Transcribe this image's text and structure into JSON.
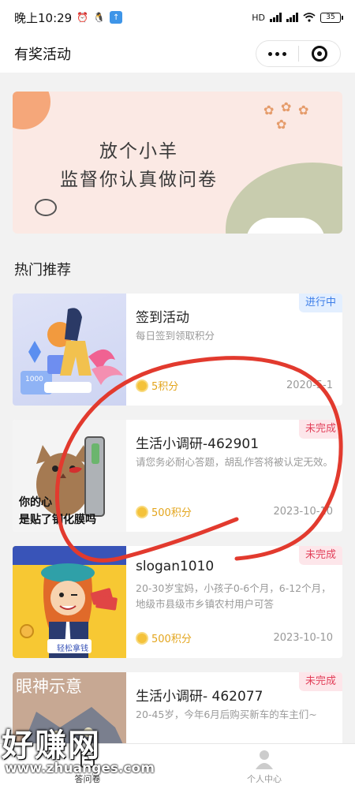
{
  "status_bar": {
    "time": "晚上10:29",
    "network": "4G",
    "hd": "HD",
    "battery": "35"
  },
  "header": {
    "title": "有奖活动",
    "more_icon": "more-dots-icon",
    "close_icon": "target-icon"
  },
  "banner": {
    "line1": "放个小羊",
    "line2": "监督你认真做问卷"
  },
  "section": {
    "title": "热门推荐"
  },
  "cards": [
    {
      "title": "签到活动",
      "desc": "每日签到领取积分",
      "points": "5积分",
      "date": "2020-5-1",
      "status": "进行中",
      "status_color": "#3d7ee8",
      "thumb_text": "1000"
    },
    {
      "title": "生活小调研-462901",
      "desc": "请您务必耐心答题，胡乱作答将被认定无效。",
      "points": "500积分",
      "date": "2023-10-10",
      "status": "未完成",
      "status_color": "#e2405a",
      "thumb_text_1": "你的心",
      "thumb_text_2": "是贴了钢化膜吗"
    },
    {
      "title": "slogan1010",
      "desc": "20-30岁宝妈，小孩子0-6个月，6-12个月，地级市县级市乡镇农村用户可答",
      "points": "500积分",
      "date": "2023-10-10",
      "status": "未完成",
      "status_color": "#e2405a",
      "thumb_text": "轻松拿钱"
    },
    {
      "title": "生活小调研- 462077",
      "desc": "20-45岁，今年6月后购买新车的车主们~",
      "status": "未完成",
      "status_color": "#e2405a",
      "thumb_text": "眼神示意"
    }
  ],
  "tabbar": {
    "tab1": "答问卷",
    "tab2": "个人中心"
  },
  "watermark": {
    "text": "好赚网",
    "url": "www.zhuanges.com"
  }
}
